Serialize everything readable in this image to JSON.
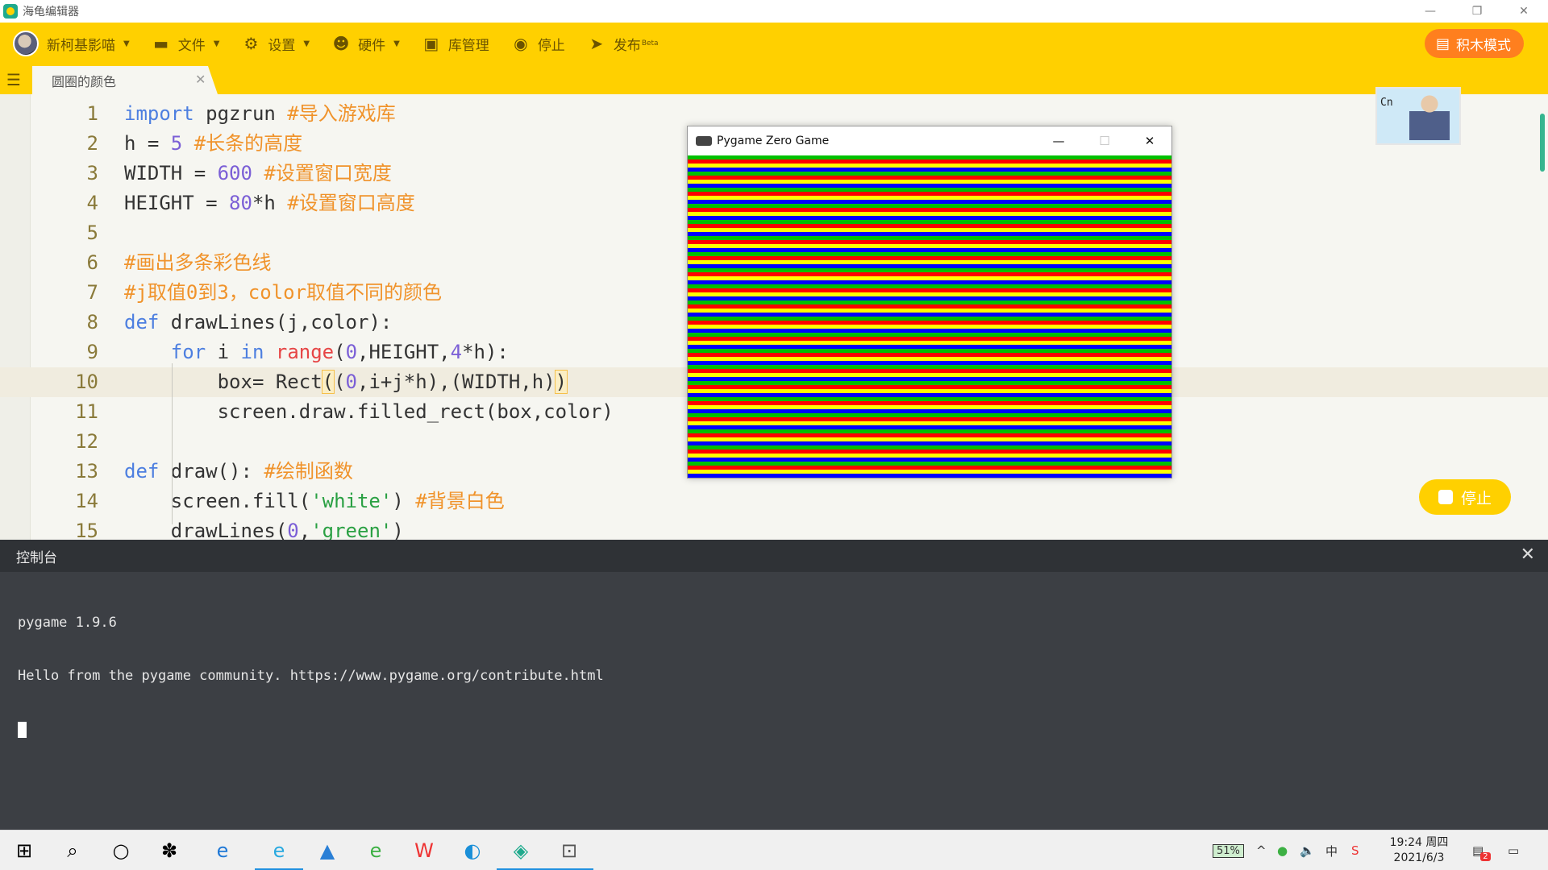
{
  "app": {
    "title": "海龟编辑器"
  },
  "toolbar": {
    "user": "新柯基影喵",
    "file": "文件",
    "settings": "设置",
    "hardware": "硬件",
    "library": "库管理",
    "stop": "停止",
    "publish": "发布",
    "beta": "Beta",
    "block_mode": "积木模式"
  },
  "tab": {
    "name": "圆圈的颜色"
  },
  "editor": {
    "lines": [
      {
        "n": "1",
        "tokens": [
          [
            "kw",
            "import"
          ],
          [
            "plain",
            " pgzrun "
          ],
          [
            "cm",
            "#导入游戏库"
          ]
        ]
      },
      {
        "n": "2",
        "tokens": [
          [
            "plain",
            "h = "
          ],
          [
            "num",
            "5"
          ],
          [
            "plain",
            " "
          ],
          [
            "cm",
            "#长条的高度"
          ]
        ]
      },
      {
        "n": "3",
        "tokens": [
          [
            "plain",
            "WIDTH = "
          ],
          [
            "num",
            "600"
          ],
          [
            "plain",
            " "
          ],
          [
            "cm",
            "#设置窗口宽度"
          ]
        ]
      },
      {
        "n": "4",
        "tokens": [
          [
            "plain",
            "HEIGHT = "
          ],
          [
            "num",
            "80"
          ],
          [
            "plain",
            "*h "
          ],
          [
            "cm",
            "#设置窗口高度"
          ]
        ]
      },
      {
        "n": "5",
        "tokens": []
      },
      {
        "n": "6",
        "tokens": [
          [
            "cm",
            "#画出多条彩色线"
          ]
        ]
      },
      {
        "n": "7",
        "tokens": [
          [
            "cm",
            "#j取值0到3，color取值不同的颜色"
          ]
        ]
      },
      {
        "n": "8",
        "tokens": [
          [
            "kw",
            "def"
          ],
          [
            "plain",
            " drawLines(j,color):"
          ]
        ]
      },
      {
        "n": "9",
        "tokens": [
          [
            "plain",
            "    "
          ],
          [
            "kw",
            "for"
          ],
          [
            "plain",
            " i "
          ],
          [
            "kw",
            "in"
          ],
          [
            "plain",
            " "
          ],
          [
            "fn",
            "range"
          ],
          [
            "plain",
            "("
          ],
          [
            "num",
            "0"
          ],
          [
            "plain",
            ",HEIGHT,"
          ],
          [
            "num",
            "4"
          ],
          [
            "plain",
            "*h):"
          ]
        ]
      },
      {
        "n": "10",
        "tokens": [
          [
            "plain",
            "        box= Rect"
          ],
          [
            "hl",
            "("
          ],
          [
            "plain",
            "("
          ],
          [
            "num",
            "0"
          ],
          [
            "plain",
            ",i+j*h),(WIDTH,h)"
          ],
          [
            "hl",
            ")"
          ]
        ]
      },
      {
        "n": "11",
        "tokens": [
          [
            "plain",
            "        screen.draw.filled_rect(box,color)"
          ]
        ]
      },
      {
        "n": "12",
        "tokens": []
      },
      {
        "n": "13",
        "tokens": [
          [
            "kw",
            "def"
          ],
          [
            "plain",
            " draw(): "
          ],
          [
            "cm",
            "#绘制函数"
          ]
        ]
      },
      {
        "n": "14",
        "tokens": [
          [
            "plain",
            "    screen.fill("
          ],
          [
            "str",
            "'white'"
          ],
          [
            "plain",
            ") "
          ],
          [
            "cm",
            "#背景白色"
          ]
        ]
      },
      {
        "n": "15",
        "tokens": [
          [
            "plain",
            "    drawLines("
          ],
          [
            "num",
            "0"
          ],
          [
            "plain",
            ","
          ],
          [
            "str",
            "'green'"
          ],
          [
            "plain",
            ")"
          ]
        ]
      }
    ],
    "active_line": 10
  },
  "widget": {
    "tag": "Cn"
  },
  "float_stop": "停止",
  "game_window": {
    "title": "Pygame Zero Game",
    "stripe_colors": [
      "#00c000",
      "#ff0000",
      "#ffff00",
      "#0000ff"
    ]
  },
  "console": {
    "title": "控制台",
    "lines": [
      "pygame 1.9.6",
      "Hello from the pygame community. https://www.pygame.org/contribute.html"
    ]
  },
  "taskbar": {
    "battery": "51%",
    "ime": "中",
    "time": "19:24 周四",
    "date": "2021/6/3",
    "badge": "2"
  }
}
